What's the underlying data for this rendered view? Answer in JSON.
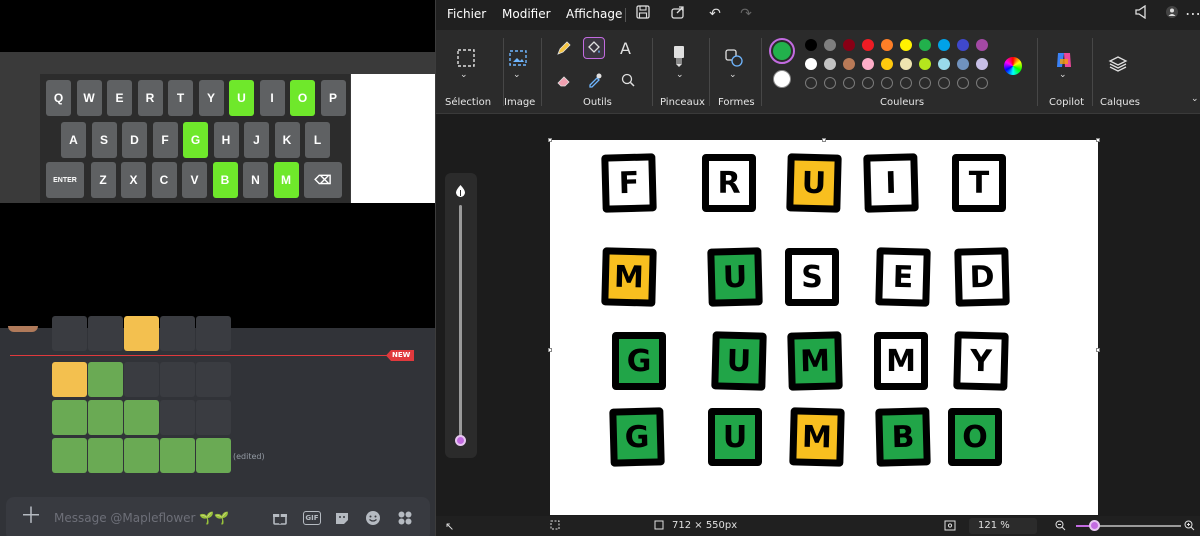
{
  "keyboard": {
    "rows": [
      [
        {
          "k": "Q",
          "s": "dark"
        },
        {
          "k": "W",
          "s": "dark"
        },
        {
          "k": "E",
          "s": "dark"
        },
        {
          "k": "R",
          "s": "dark"
        },
        {
          "k": "T",
          "s": "dark"
        },
        {
          "k": "Y",
          "s": "dark"
        },
        {
          "k": "U",
          "s": "green"
        },
        {
          "k": "I",
          "s": "dark"
        },
        {
          "k": "O",
          "s": "green"
        },
        {
          "k": "P",
          "s": "dark"
        }
      ],
      [
        {
          "k": "A",
          "s": "dark"
        },
        {
          "k": "S",
          "s": "dark"
        },
        {
          "k": "D",
          "s": "dark"
        },
        {
          "k": "F",
          "s": "dark"
        },
        {
          "k": "G",
          "s": "green"
        },
        {
          "k": "H",
          "s": "dark"
        },
        {
          "k": "J",
          "s": "dark"
        },
        {
          "k": "K",
          "s": "dark"
        },
        {
          "k": "L",
          "s": "dark"
        }
      ],
      [
        {
          "k": "ENTER",
          "s": "dark"
        },
        {
          "k": "Z",
          "s": "dark"
        },
        {
          "k": "X",
          "s": "dark"
        },
        {
          "k": "C",
          "s": "dark"
        },
        {
          "k": "V",
          "s": "dark"
        },
        {
          "k": "B",
          "s": "green"
        },
        {
          "k": "N",
          "s": "dark"
        },
        {
          "k": "M",
          "s": "green"
        },
        {
          "k": "⌫",
          "s": "dark"
        }
      ]
    ]
  },
  "discord": {
    "new_badge": "NEW",
    "edited_label": "(edited)",
    "message_placeholder": "Message @Mapleflower 🌱🌱",
    "grid_rows": [
      [
        "empty",
        "empty",
        "yellow",
        "empty",
        "empty"
      ],
      [
        "yellow",
        "green",
        "empty",
        "empty",
        "empty"
      ],
      [
        "green",
        "green",
        "green",
        "empty",
        "empty"
      ],
      [
        "green",
        "green",
        "green",
        "green",
        "green"
      ]
    ],
    "icons": [
      "plus-icon",
      "gift-icon",
      "gif-icon",
      "sticker-icon",
      "emoji-icon",
      "apps-icon"
    ]
  },
  "paint": {
    "menu": {
      "file": "Fichier",
      "edit": "Modifier",
      "view": "Affichage"
    },
    "groups": {
      "selection": "Sélection",
      "image": "Image",
      "tools": "Outils",
      "brushes": "Pinceaux",
      "shapes": "Formes",
      "colors": "Couleurs",
      "copilot": "Copilot",
      "layers": "Calques"
    },
    "palette_row1": [
      "#000000",
      "#7f7f7f",
      "#880015",
      "#ed1c24",
      "#ff7f27",
      "#fff200",
      "#22b14c",
      "#00a2e8",
      "#3f48cc",
      "#a349a4"
    ],
    "palette_row2": [
      "#ffffff",
      "#c3c3c3",
      "#b97a57",
      "#ffaec9",
      "#ffc90e",
      "#efe4b0",
      "#b5e61d",
      "#99d9ea",
      "#7092be",
      "#c8bfe7"
    ],
    "primary_color": "#22b14c",
    "secondary_color": "#ffffff",
    "canvas_size": "712 × 550px",
    "zoom": "121 %",
    "board": [
      [
        {
          "l": "F",
          "c": "w"
        },
        {
          "l": "R",
          "c": "w"
        },
        {
          "l": "U",
          "c": "o"
        },
        {
          "l": "I",
          "c": "w"
        },
        {
          "l": "T",
          "c": "w"
        }
      ],
      [
        {
          "l": "M",
          "c": "o"
        },
        {
          "l": "U",
          "c": "g"
        },
        {
          "l": "S",
          "c": "w"
        },
        {
          "l": "E",
          "c": "w"
        },
        {
          "l": "D",
          "c": "w"
        }
      ],
      [
        {
          "l": "G",
          "c": "g"
        },
        {
          "l": "U",
          "c": "g"
        },
        {
          "l": "M",
          "c": "g"
        },
        {
          "l": "M",
          "c": "w"
        },
        {
          "l": "Y",
          "c": "w"
        }
      ],
      [
        {
          "l": "G",
          "c": "g"
        },
        {
          "l": "U",
          "c": "g"
        },
        {
          "l": "M",
          "c": "o"
        },
        {
          "l": "B",
          "c": "g"
        },
        {
          "l": "O",
          "c": "g"
        }
      ]
    ]
  }
}
